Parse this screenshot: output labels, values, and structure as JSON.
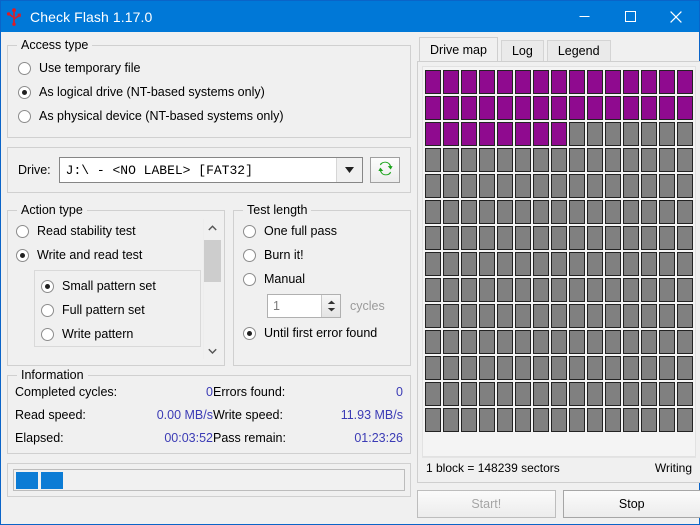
{
  "window": {
    "title": "Check Flash 1.17.0",
    "icon": "usb-icon",
    "minimize_label": "—",
    "maximize_label": "☐",
    "close_label": "✕",
    "accent_color": "#0078d7"
  },
  "access_type": {
    "legend": "Access type",
    "options": [
      {
        "label": "Use temporary file",
        "checked": false
      },
      {
        "label": "As logical drive (NT-based systems only)",
        "checked": true
      },
      {
        "label": "As physical device (NT-based systems only)",
        "checked": false
      }
    ]
  },
  "drive": {
    "label": "Drive:",
    "value": "J:\\ - <NO LABEL> [FAT32]",
    "dropdown_icon": "chevron-down-icon",
    "refresh_icon": "refresh-icon",
    "refresh_color": "#19a319"
  },
  "action_type": {
    "legend": "Action type",
    "options": [
      {
        "label": "Read stability test",
        "checked": false
      },
      {
        "label": "Write and read test",
        "checked": true
      }
    ],
    "pattern_options": [
      {
        "label": "Small pattern set",
        "checked": true
      },
      {
        "label": "Full pattern set",
        "checked": false
      },
      {
        "label": "Write pattern",
        "checked": false
      }
    ],
    "scroll_up_icon": "chevron-up-icon",
    "scroll_down_icon": "chevron-down-icon"
  },
  "test_length": {
    "legend": "Test length",
    "options": [
      {
        "label": "One full pass",
        "checked": false
      },
      {
        "label": "Burn it!",
        "checked": false
      },
      {
        "label": "Manual",
        "checked": false
      },
      {
        "label": "Until first error found",
        "checked": true
      }
    ],
    "cycles_value": "1",
    "cycles_units": "cycles"
  },
  "information": {
    "legend": "Information",
    "value_color": "#3b3bb5",
    "rows": [
      {
        "label_left": "Completed cycles:",
        "value_left": "0",
        "label_right": "Errors found:",
        "value_right": "0"
      },
      {
        "label_left": "Read speed:",
        "value_left": "0.00 MB/s",
        "label_right": "Write speed:",
        "value_right": "11.93 MB/s"
      },
      {
        "label_left": "Elapsed:",
        "value_left": "00:03:52",
        "label_right": "Pass remain:",
        "value_right": "01:23:26"
      }
    ]
  },
  "progress": {
    "filled_chunks": 2,
    "fill_color": "#0c7cd5"
  },
  "tabs": [
    {
      "label": "Drive map",
      "active": true
    },
    {
      "label": "Log",
      "active": false
    },
    {
      "label": "Legend",
      "active": false
    }
  ],
  "drive_map": {
    "columns": 15,
    "rows": 14,
    "written_blocks": 38,
    "written_color": "#8f0a8f",
    "empty_color": "#808080",
    "status_left": "1 block = 148239 sectors",
    "status_right": "Writing"
  },
  "footer": {
    "start_label": "Start!",
    "start_enabled": false,
    "stop_label": "Stop",
    "stop_enabled": true
  }
}
